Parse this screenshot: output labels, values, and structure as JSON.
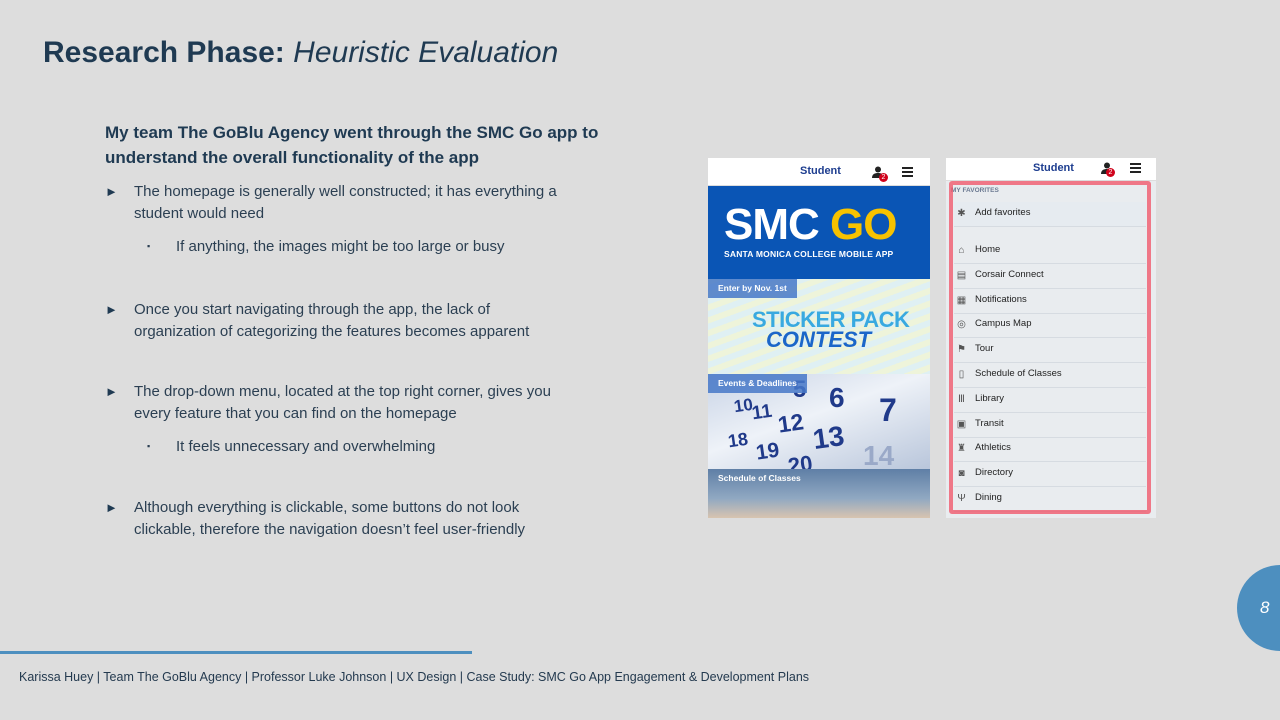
{
  "title": {
    "bold": "Research Phase:",
    "italic": "Heuristic Evaluation"
  },
  "lead": "My team The GoBlu Agency went through the SMC Go app to understand the overall functionality of the app",
  "bullets": [
    {
      "text": "The homepage is generally well constructed; it has everything a student would need",
      "sub": "If anything, the images might be too large or busy"
    },
    {
      "text": "Once you start navigating through the app, the lack of organization of categorizing the features becomes apparent"
    },
    {
      "text": "The drop-down menu, located at the top right corner, gives you every feature that you can find on the homepage",
      "sub": "It feels unnecessary and overwhelming"
    },
    {
      "text": "Although everything is clickable, some buttons do not look clickable, therefore the navigation doesn’t feel user-friendly"
    }
  ],
  "bullet_marker": "►",
  "sub_marker": "▪",
  "phone1": {
    "header_label": "Student",
    "badge": "2",
    "banner_main_a": "SMC ",
    "banner_main_b": "GO",
    "banner_sub": "SANTA MONICA COLLEGE MOBILE APP",
    "tiles": [
      "Enter by Nov. 1st",
      "Events & Deadlines",
      "Schedule of Classes"
    ],
    "sticker_line1": "STICKER PACK",
    "sticker_line2": "CONTEST",
    "calendar_numbers": [
      "5",
      "6",
      "7",
      "10",
      "11",
      "12",
      "13",
      "18",
      "19",
      "20",
      "14"
    ]
  },
  "phone2": {
    "header_label": "Student",
    "badge": "2",
    "favorites_label": "MY FAVORITES",
    "add_favorites": "Add favorites",
    "items": [
      {
        "label": "Home",
        "icon": "home-icon",
        "glyph": "⌂"
      },
      {
        "label": "Corsair Connect",
        "icon": "list-icon",
        "glyph": "▤"
      },
      {
        "label": "Notifications",
        "icon": "calendar-icon",
        "glyph": "▦"
      },
      {
        "label": "Campus Map",
        "icon": "target-icon",
        "glyph": "◎"
      },
      {
        "label": "Tour",
        "icon": "flag-icon",
        "glyph": "⚑"
      },
      {
        "label": "Schedule of Classes",
        "icon": "book-icon",
        "glyph": "▯"
      },
      {
        "label": "Library",
        "icon": "library-icon",
        "glyph": "Ⅲ"
      },
      {
        "label": "Transit",
        "icon": "bus-icon",
        "glyph": "▣"
      },
      {
        "label": "Athletics",
        "icon": "trophy-icon",
        "glyph": "♜"
      },
      {
        "label": "Directory",
        "icon": "directory-icon",
        "glyph": "◙"
      },
      {
        "label": "Dining",
        "icon": "dining-icon",
        "glyph": "Ψ"
      }
    ]
  },
  "page_number": "8",
  "footer": "Karissa Huey | Team The GoBlu Agency | Professor Luke Johnson | UX Design | Case Study: SMC Go App Engagement & Development Plans",
  "colors": {
    "accent": "#4d8fbf",
    "title": "#1f3a52",
    "highlight": "#f05064",
    "app_blue": "#0a55b5"
  }
}
